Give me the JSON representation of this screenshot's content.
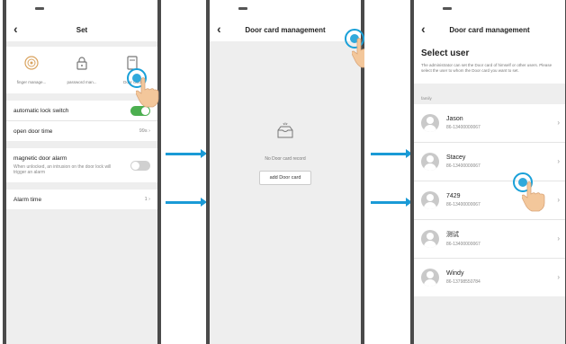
{
  "screen1": {
    "title": "Set",
    "icons": [
      {
        "icon": "fingerprint-icon",
        "label": "finger manage..."
      },
      {
        "icon": "lock-icon",
        "label": "password man..."
      },
      {
        "icon": "door-card-icon",
        "label": "Door card"
      }
    ],
    "auto_lock_label": "automatic lock switch",
    "auto_lock_on": true,
    "open_door_time_label": "open door time",
    "open_door_time_value": "99s",
    "magnetic_alarm_label": "magnetic door alarm",
    "magnetic_alarm_desc": "When unlocked, an intrusion on the door lock will trigger an alarm",
    "magnetic_alarm_on": false,
    "alarm_time_label": "Alarm time",
    "alarm_time_value": "1"
  },
  "screen2": {
    "title": "Door card management",
    "empty_text": "No Door card record",
    "add_button": "add Door card"
  },
  "screen3": {
    "title": "Door card management",
    "heading": "Select user",
    "description": "The administrator can set the Door card of himself or other users. Please select the user to whom the Door card you want to set.",
    "group": "family",
    "users": [
      {
        "name": "Jason",
        "phone": "86-13400000067"
      },
      {
        "name": "Stacey",
        "phone": "86-13400000067"
      },
      {
        "name": "7429",
        "phone": "86-13400000067"
      },
      {
        "name": "测试",
        "phone": "86-13400000067"
      },
      {
        "name": "Windy",
        "phone": "86-13798550784"
      }
    ]
  },
  "colors": {
    "accent": "#1a9ad6",
    "toggle_on": "#4caf50",
    "background": "#eeeeee"
  }
}
